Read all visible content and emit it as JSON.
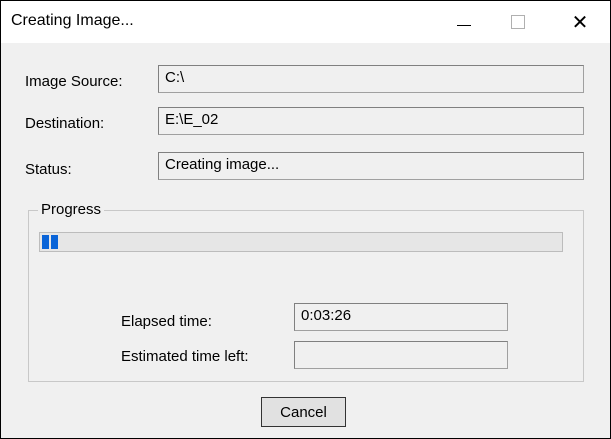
{
  "window": {
    "title": "Creating Image...",
    "controls": {
      "close_glyph": "✕"
    }
  },
  "fields": {
    "source": {
      "label": "Image Source:",
      "value": "C:\\"
    },
    "destination": {
      "label": "Destination:",
      "value": "E:\\E_02"
    },
    "status": {
      "label": "Status:",
      "value": "Creating image..."
    }
  },
  "progress": {
    "legend": "Progress",
    "percent": 3,
    "color": "#0a64d8",
    "elapsed_label": "Elapsed time:",
    "elapsed_value": "0:03:26",
    "remaining_label": "Estimated time left:",
    "remaining_value": ""
  },
  "buttons": {
    "cancel": "Cancel"
  },
  "icons": [
    "minimize-icon",
    "maximize-icon",
    "close-icon"
  ]
}
